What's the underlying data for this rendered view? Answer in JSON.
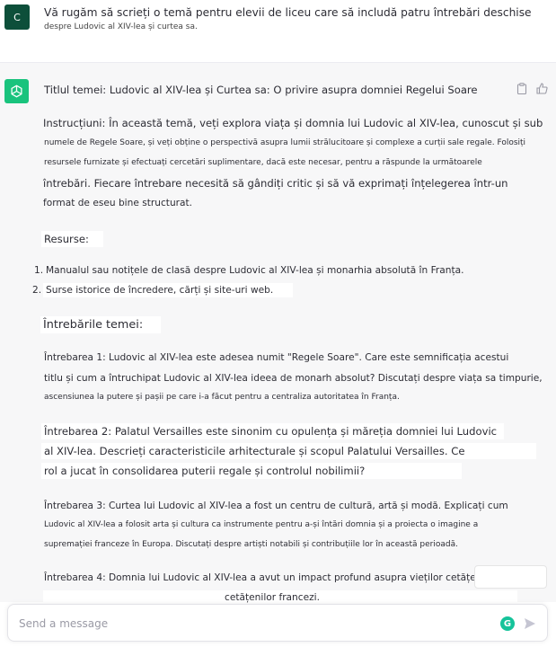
{
  "user_message": {
    "avatar_letter": "C",
    "line1": "Vă rugăm să scrieți o temă pentru elevii de liceu care să includă patru întrebări deschise",
    "line2": "despre Ludovic al XIV-lea și curtea sa."
  },
  "assistant_message": {
    "title": "Titlul temei: Ludovic al XIV-lea și Curtea sa: O privire asupra domniei Regelui Soare",
    "instructions": [
      "Instrucțiuni: În această temă, veți explora viața și domnia lui Ludovic al XIV-lea, cunoscut și sub",
      "numele de Regele Soare, și veți obține o perspectivă asupra lumii strălucitoare și complexe a curții sale regale. Folosiți",
      "resursele furnizate și efectuați cercetări suplimentare, dacă este necesar, pentru a răspunde la următoarele",
      "întrebări. Fiecare întrebare necesită să gândiți critic și să vă exprimați înțelegerea într-un",
      "format de eseu bine structurat."
    ],
    "resources_heading": "Resurse:",
    "resources": [
      {
        "num": "1.",
        "text": "Manualul sau notițele de clasă despre Ludovic al XIV-lea și monarhia absolută în Franța."
      },
      {
        "num": "2.",
        "text": "Surse istorice de încredere, cărți și site-uri web."
      }
    ],
    "questions_heading": "Întrebările temei:",
    "q1": [
      "Întrebarea 1: Ludovic al XIV-lea este adesea numit \"Regele Soare\". Care este semnificația acestui",
      "titlu și cum a întruchipat Ludovic al XIV-lea ideea de monarh absolut? Discutați despre viața sa timpurie,",
      "ascensiunea la putere și pașii pe care i-a făcut pentru a centraliza autoritatea în Franța."
    ],
    "q2": [
      "Întrebarea 2: Palatul Versailles este sinonim cu opulența și măreția domniei lui Ludovic",
      "al XIV-lea. Descrieți caracteristicile arhitecturale și scopul Palatului Versailles. Ce",
      "rol a jucat în consolidarea puterii regale și controlul nobilimii?"
    ],
    "q3": [
      "Întrebarea 3: Curtea lui Ludovic al XIV-lea a fost un centru de cultură, artă și modă. Explicați cum",
      "Ludovic al XIV-lea a folosit arta și cultura ca instrumente pentru a-și întări domnia și a proiecta o imagine a",
      "supremației franceze în Europa. Discutați despre artiști notabili și contribuțiile lor în această perioadă."
    ],
    "q4": [
      "Întrebarea 4: Domnia lui Ludovic al XIV-lea a avut un impact profund asupra vieților cetățenilor",
      "cetățenilor francezi."
    ]
  },
  "icons": {
    "copy": "clipboard-icon",
    "thumbs_up": "thumbs-up-icon",
    "assistant_logo": "openai-logo-icon",
    "grammarly": "grammarly-icon",
    "send": "send-icon"
  },
  "composer": {
    "placeholder": "Send a message",
    "value": ""
  },
  "colors": {
    "assistant_avatar": "#19c37d",
    "user_avatar": "#0d4f3a",
    "assistant_bg": "#f7f7f8",
    "grammarly": "#15c39a"
  }
}
